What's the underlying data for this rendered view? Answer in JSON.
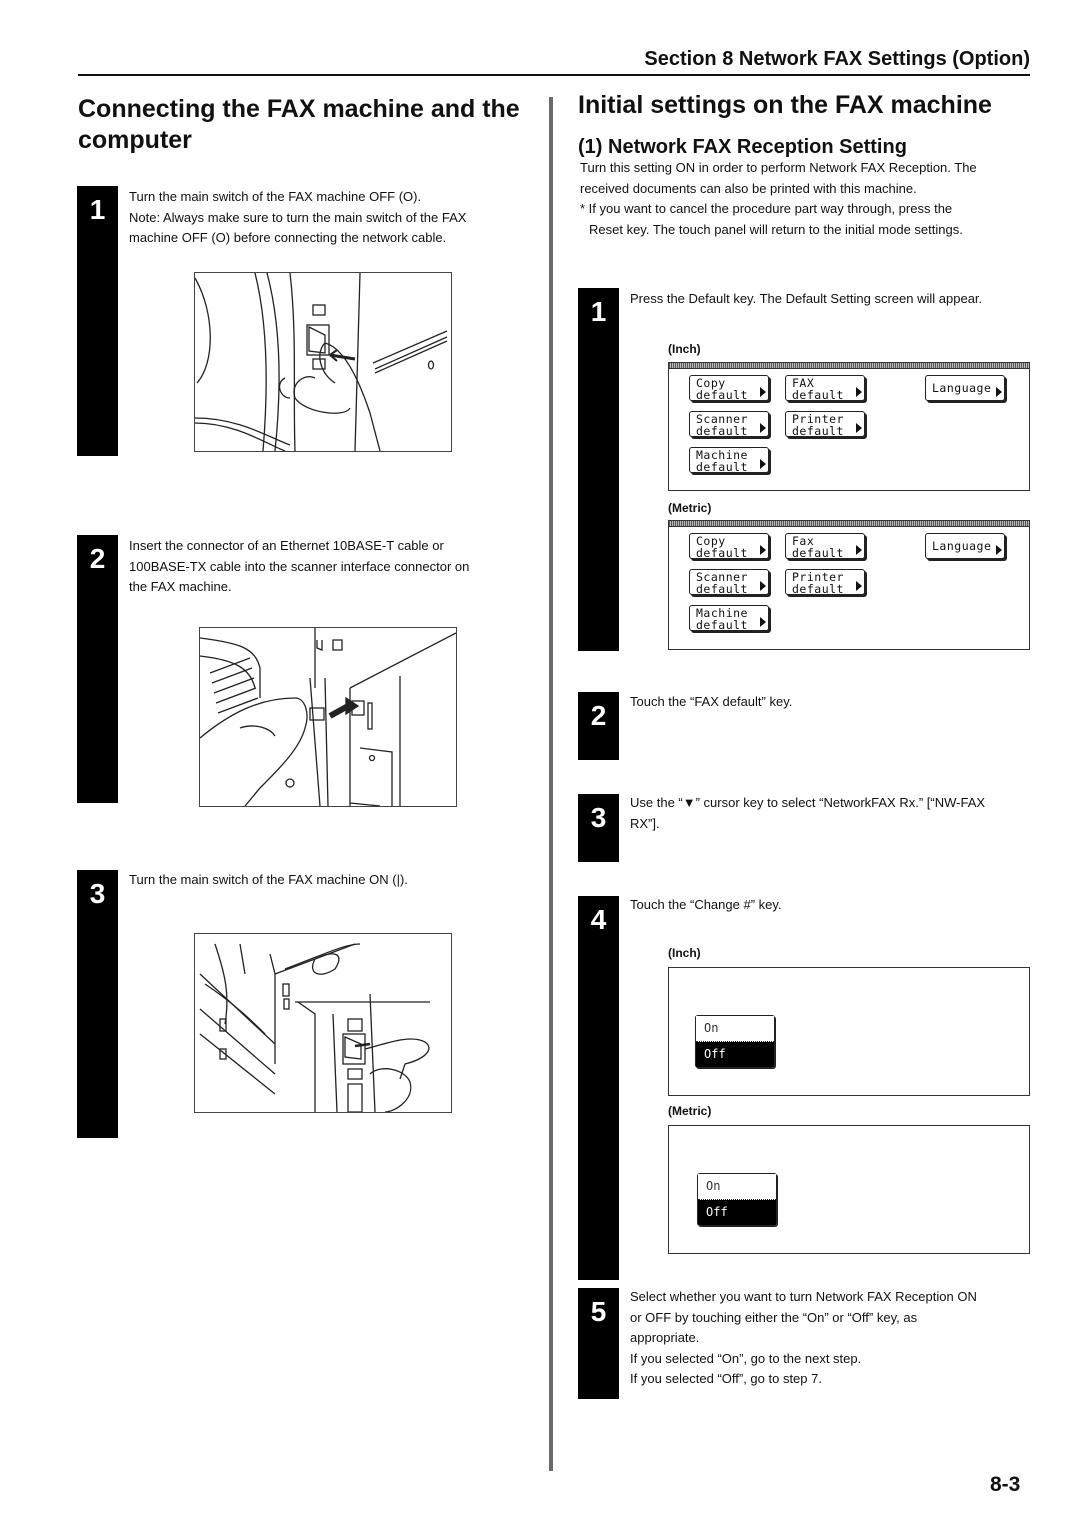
{
  "header": {
    "section_title": "Section 8 Network FAX Settings (Option)"
  },
  "left": {
    "title_line1": "Connecting the FAX machine and the",
    "title_line2": "computer",
    "steps": [
      {
        "number": "1",
        "lines": [
          "Turn the main switch of the FAX machine OFF (O).",
          "Note: Always make sure to turn the main switch of the FAX",
          "machine OFF (O) before connecting the network cable."
        ],
        "figure": "main-switch-off-illustration"
      },
      {
        "number": "2",
        "lines": [
          "Insert the connector of an Ethernet 10BASE-T cable or",
          "100BASE-TX cable into the scanner interface connector on",
          "the FAX machine."
        ],
        "figure": "ethernet-connector-illustration"
      },
      {
        "number": "3",
        "lines": [
          "Turn the main switch of the FAX machine ON (|)."
        ],
        "figure": "main-switch-on-illustration"
      }
    ]
  },
  "right": {
    "title": "Initial settings on the FAX machine",
    "subtitle": "(1) Network FAX Reception Setting",
    "intro_lines": [
      "Turn this setting ON in order to perform Network FAX Reception. The",
      "received documents can also be printed with this machine."
    ],
    "note_lines": [
      "* If you want to cancel the procedure part way through, press the",
      "Reset key. The touch panel will return to the initial mode settings."
    ],
    "steps": [
      {
        "number": "1",
        "lines": [
          "Press the Default key. The Default Setting screen will appear."
        ]
      },
      {
        "number": "2",
        "lines": [
          "Touch the “FAX default” key."
        ]
      },
      {
        "number": "3",
        "lines": [
          "Use the “▼” cursor key to select “NetworkFAX Rx.” [“NW-FAX",
          "RX”]."
        ]
      },
      {
        "number": "4",
        "lines": [
          "Touch the “Change #” key."
        ]
      },
      {
        "number": "5",
        "lines": [
          "Select whether you want to turn Network FAX Reception ON",
          "or OFF by touching either the “On” or “Off” key, as",
          "appropriate.",
          "If you selected “On”, go to the next step.",
          "If you selected “Off”, go to step 7."
        ]
      }
    ],
    "default_screens": [
      {
        "label": "(Inch)",
        "keys": [
          [
            "Copy",
            "default"
          ],
          [
            "FAX",
            "default"
          ],
          [
            "Language"
          ],
          [
            "Scanner",
            "default"
          ],
          [
            "Printer",
            "default"
          ],
          [
            "Machine",
            "default"
          ]
        ]
      },
      {
        "label": "(Metric)",
        "keys": [
          [
            "Copy",
            "default"
          ],
          [
            "Fax",
            "default"
          ],
          [
            "Language"
          ],
          [
            "Scanner",
            "default"
          ],
          [
            "Printer",
            "default"
          ],
          [
            "Machine",
            "default"
          ]
        ]
      }
    ],
    "toggle_screens": [
      {
        "label": "(Inch)",
        "on": "On",
        "off": "Off",
        "selected": "Off"
      },
      {
        "label": "(Metric)",
        "on": "On",
        "off": "Off",
        "selected": "Off"
      }
    ]
  },
  "footer": {
    "page_number": "8-3"
  }
}
